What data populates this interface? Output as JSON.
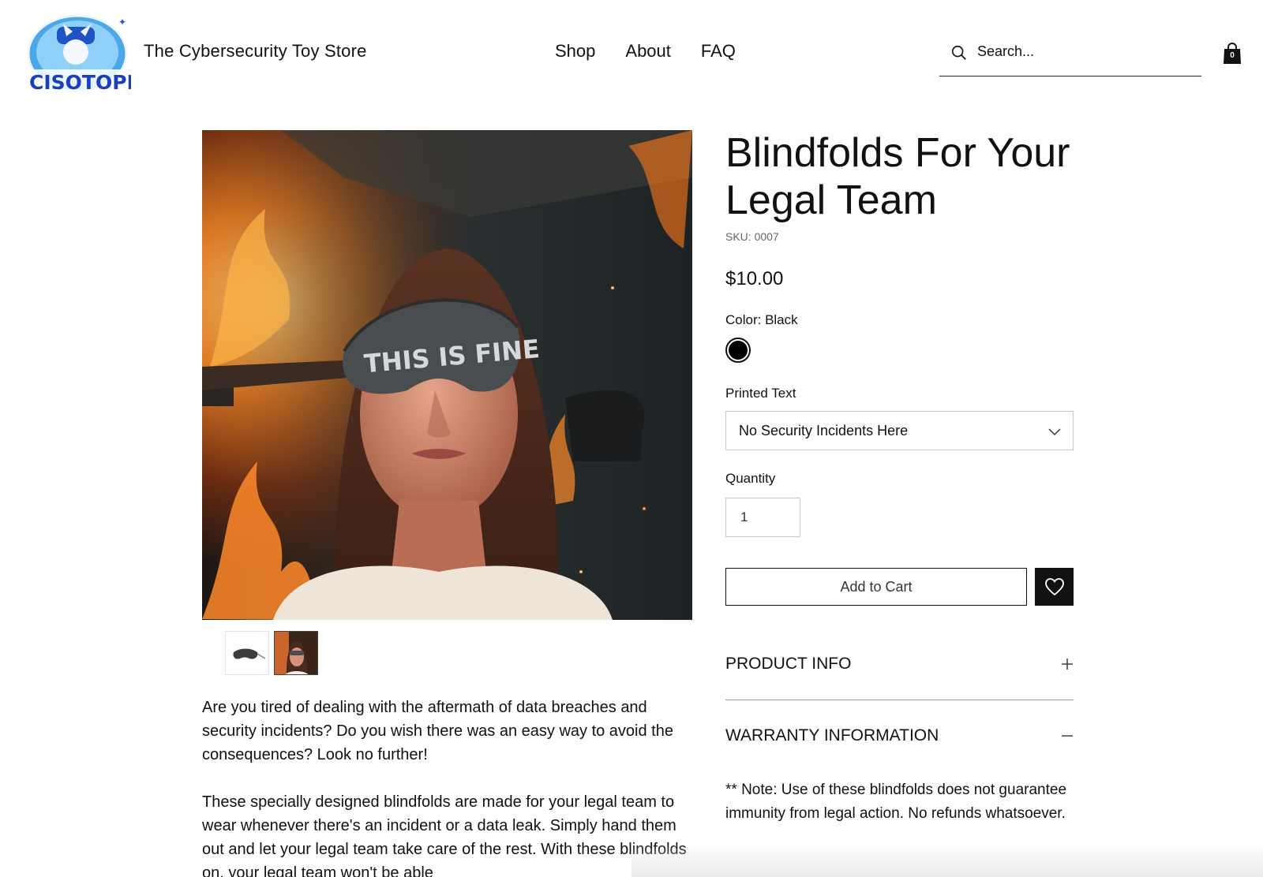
{
  "header": {
    "logo_text": "CISOTOPIA",
    "store_name": "The Cybersecurity Toy Store",
    "nav": [
      {
        "label": "Shop"
      },
      {
        "label": "About"
      },
      {
        "label": "FAQ"
      }
    ],
    "search_placeholder": "Search...",
    "cart_count": "0"
  },
  "product": {
    "image_text": "THIS IS FINE",
    "title": "Blindfolds For Your Legal Team",
    "sku": "SKU: 0007",
    "price": "$10.00",
    "color_label": "Color: Black",
    "color_value": "#000000",
    "printed_text_label": "Printed Text",
    "printed_text_selected": "No Security Incidents Here",
    "quantity_label": "Quantity",
    "quantity_value": "1",
    "add_to_cart": "Add to Cart"
  },
  "description": [
    "Are you tired of dealing with the aftermath of data breaches and security incidents? Do you wish there was an easy way to avoid the consequences? Look no further!",
    "These specially designed blindfolds are made for your legal team to wear whenever there's an incident or a data leak. Simply hand them out and let your legal team take care of the rest. With these blindfolds on, your legal team won't be able"
  ],
  "accordion": {
    "product_info": {
      "title": "PRODUCT INFO",
      "icon": "plus-icon"
    },
    "warranty": {
      "title": "WARRANTY INFORMATION",
      "icon": "minus-icon",
      "body": "** Note: Use of these blindfolds does not guarantee immunity from legal action. No refunds whatsoever."
    }
  }
}
